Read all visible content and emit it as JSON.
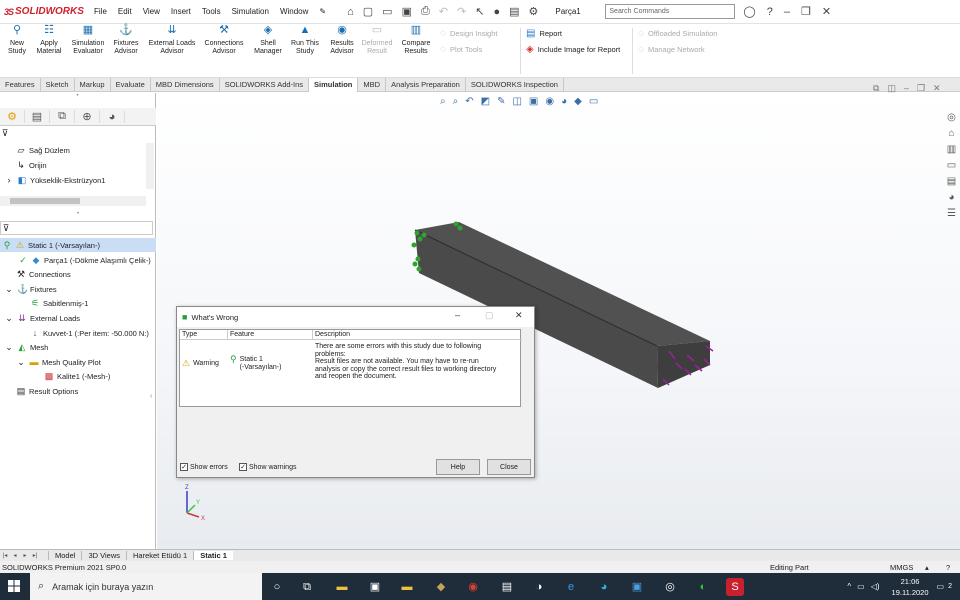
{
  "app": {
    "logo_prefix": "3S",
    "logo": "SOLIDWORKS",
    "part_name": "Parça1",
    "search_placeholder": "Search Commands"
  },
  "menu": [
    "File",
    "Edit",
    "View",
    "Insert",
    "Tools",
    "Simulation",
    "Window"
  ],
  "commands": {
    "new_study": "New Study",
    "apply_material": "Apply Material",
    "sim_evaluator": "Simulation Evaluator",
    "fixtures_advisor": "Fixtures Advisor",
    "external_loads_advisor": "External Loads Advisor",
    "connections_advisor": "Connections Advisor",
    "shell_manager": "Shell Manager",
    "run_this_study": "Run This Study",
    "results_advisor": "Results Advisor",
    "deformed_result": "Deformed Result",
    "compare_results": "Compare Results",
    "design_insight": "Design Insight",
    "plot_tools": "Plot Tools",
    "report": "Report",
    "include_image": "Include Image for Report",
    "offloaded_sim": "Offloaded Simulation",
    "manage_network": "Manage Network"
  },
  "tabs": [
    "Features",
    "Sketch",
    "Markup",
    "Evaluate",
    "MBD Dimensions",
    "SOLIDWORKS Add-Ins",
    "Simulation",
    "MBD",
    "Analysis Preparation",
    "SOLIDWORKS Inspection"
  ],
  "active_tab": "Simulation",
  "feature_tree": [
    "Sağ Düzlem",
    "Orijin",
    "Yükseklik-Ekstrüzyon1"
  ],
  "study_tree": {
    "study": "Static 1 (-Varsayılan-)",
    "part": "Parça1 (-Dökme Alaşımlı Çelik-)",
    "connections": "Connections",
    "fixtures": "Fixtures",
    "fixture1": "Sabitlenmiş-1",
    "external_loads": "External Loads",
    "load1": "Kuvvet-1 (:Per item: -50.000 N:)",
    "mesh": "Mesh",
    "mesh_quality_plot": "Mesh Quality Plot",
    "quality1": "Kalite1 (-Mesh-)",
    "result_options": "Result Options"
  },
  "dialog": {
    "title": "What's Wrong",
    "col_type": "Type",
    "col_feature": "Feature",
    "col_description": "Description",
    "row_type": "Warning",
    "row_feature_1": "Static 1",
    "row_feature_2": "(-Varsayılan-)",
    "desc_1": "There are some errors with this study due to following",
    "desc_2": "problems:",
    "desc_3": "Result files are not available. You may have to re-run",
    "desc_4": "analysis or copy the correct result files to working directory",
    "desc_5": "and reopen the document.",
    "show_errors": "Show errors",
    "show_warnings": "Show warnings",
    "help": "Help",
    "close": "Close"
  },
  "bottom_tabs": [
    "Model",
    "3D Views",
    "Hareket Etüdü 1",
    "Static 1"
  ],
  "status": {
    "left": "SOLIDWORKS Premium 2021 SP0.0",
    "mode": "Editing Part",
    "units": "MMGS"
  },
  "taskbar": {
    "search": "Aramak için buraya yazın",
    "time": "21:06",
    "date": "19.11.2020",
    "notifications": "2"
  }
}
